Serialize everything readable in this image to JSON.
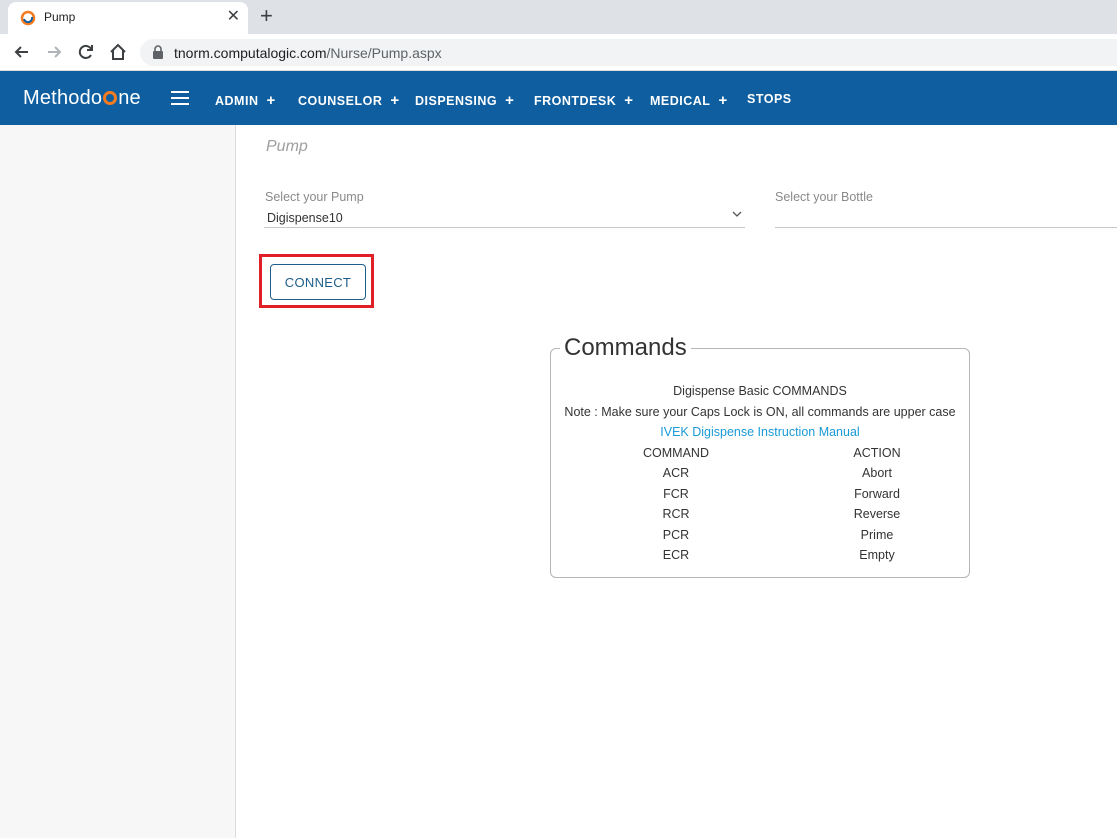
{
  "browser": {
    "tab_title": "Pump",
    "url_domain": "tnorm.computalogic.com",
    "url_path": "/Nurse/Pump.aspx"
  },
  "appnav": {
    "logo_pre": "Methodo",
    "logo_post": "ne",
    "menu": [
      "ADMIN",
      "COUNSELOR",
      "DISPENSING",
      "FRONTDESK",
      "MEDICAL",
      "STOPS"
    ],
    "plus": "+"
  },
  "page": {
    "title": "Pump",
    "pump_label": "Select your Pump",
    "pump_value": "Digispense10",
    "bottle_label": "Select your Bottle",
    "connect_label": "CONNECT"
  },
  "commands": {
    "legend": "Commands",
    "heading": "Digispense Basic COMMANDS",
    "note": "Note : Make sure your Caps Lock is ON, all commands are upper case",
    "manual_link": "IVEK Digispense Instruction Manual",
    "col_command": "COMMAND",
    "col_action": "ACTION",
    "rows": [
      {
        "command": "ACR",
        "action": "Abort"
      },
      {
        "command": "FCR",
        "action": "Forward"
      },
      {
        "command": "RCR",
        "action": "Reverse"
      },
      {
        "command": "PCR",
        "action": "Prime"
      },
      {
        "command": "ECR",
        "action": "Empty"
      }
    ]
  },
  "colors": {
    "nav_blue": "#0f5fa0",
    "highlight_red": "#e01f26",
    "link_blue": "#1a9ad6",
    "logo_orange": "#f47b20"
  }
}
